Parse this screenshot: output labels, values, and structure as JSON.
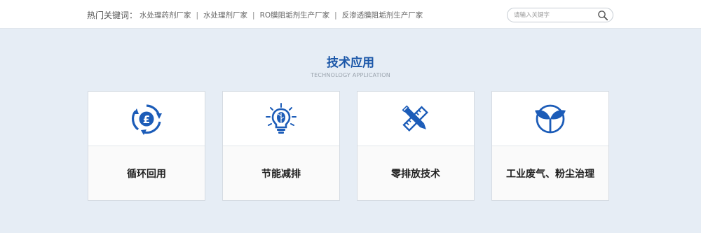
{
  "topbar": {
    "hot_label": "热门关键词：",
    "links": [
      "水处理药剂厂家",
      "水处理剂厂家",
      "RO膜阻垢剂生产厂家",
      "反渗透膜阻垢剂生产厂家"
    ],
    "separator": "|",
    "search": {
      "placeholder": "请输入关键字",
      "value": "",
      "button_icon": "search-icon"
    }
  },
  "section": {
    "title": "技术应用",
    "subtitle": "TECHNOLOGY APPLICATION"
  },
  "cards": [
    {
      "label": "循环回用",
      "icon": "recycle-pound-icon"
    },
    {
      "label": "节能减排",
      "icon": "lightbulb-leaf-icon"
    },
    {
      "label": "零排放技术",
      "icon": "pencil-ruler-icon"
    },
    {
      "label": "工业废气、粉尘治理",
      "icon": "sprout-circle-icon"
    }
  ],
  "colors": {
    "accent": "#1a56a8",
    "icon_blue": "#1c5cb8",
    "background": "#e6edf5"
  }
}
